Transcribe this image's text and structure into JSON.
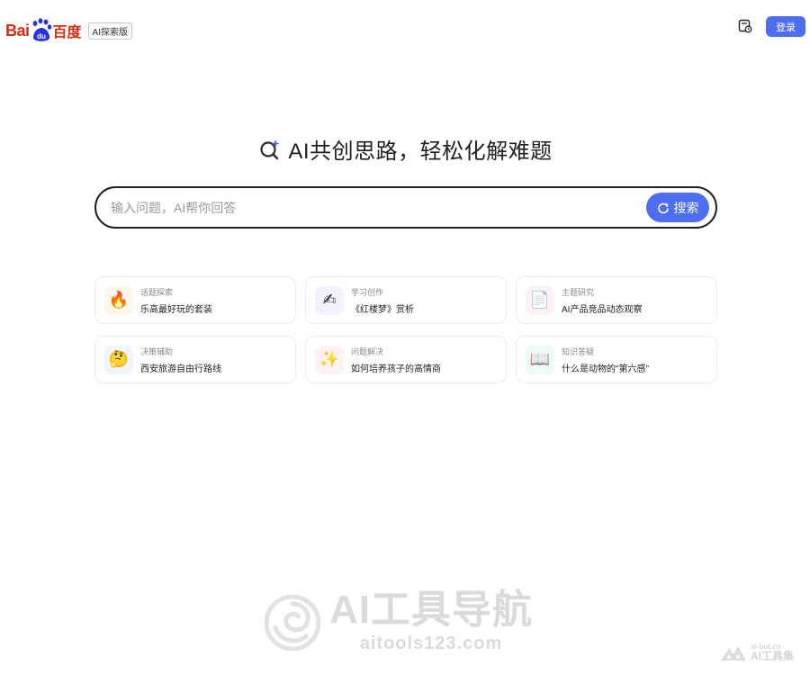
{
  "header": {
    "logo_left": "Bai",
    "logo_du": "du",
    "logo_right": "百度",
    "logo_tag": "AI探索版",
    "history_icon": "history-icon",
    "login_label": "登录"
  },
  "hero": {
    "icon": "ai-search-sparkle-icon",
    "title": "AI共创思路，轻松化解难题"
  },
  "search": {
    "placeholder": "输入问题，AI帮你回答",
    "button_label": "搜索"
  },
  "cards": [
    {
      "category": "话题探索",
      "question": "乐高最好玩的套装",
      "icon": "fire-icon",
      "emoji": "🔥",
      "bg": "#fff6ea"
    },
    {
      "category": "学习创作",
      "question": "《红楼梦》赏析",
      "icon": "pencil-icon",
      "emoji": "✍",
      "bg": "#f4f0ff"
    },
    {
      "category": "主题研究",
      "question": "AI产品竞品动态观察",
      "icon": "document-icon",
      "emoji": "📄",
      "bg": "#fff1f1"
    },
    {
      "category": "决策辅助",
      "question": "西安旅游自由行路线",
      "icon": "thinking-face-icon",
      "emoji": "🤔",
      "bg": "#eef6ff"
    },
    {
      "category": "问题解决",
      "question": "如何培养孩子的高情商",
      "icon": "sparkles-icon",
      "emoji": "✨",
      "bg": "#fff1f5"
    },
    {
      "category": "知识答疑",
      "question": "什么是动物的\"第六感\"",
      "icon": "open-book-icon",
      "emoji": "📖",
      "bg": "#eefaf6"
    }
  ],
  "watermark": {
    "title": "AI工具导航",
    "url": "aitools123.com",
    "corner_url": "ai-bot.cn",
    "corner_name": "AI工具集"
  },
  "colors": {
    "accent": "#4e6ef2",
    "brand_red": "#de2910",
    "brand_blue": "#2932e1"
  }
}
